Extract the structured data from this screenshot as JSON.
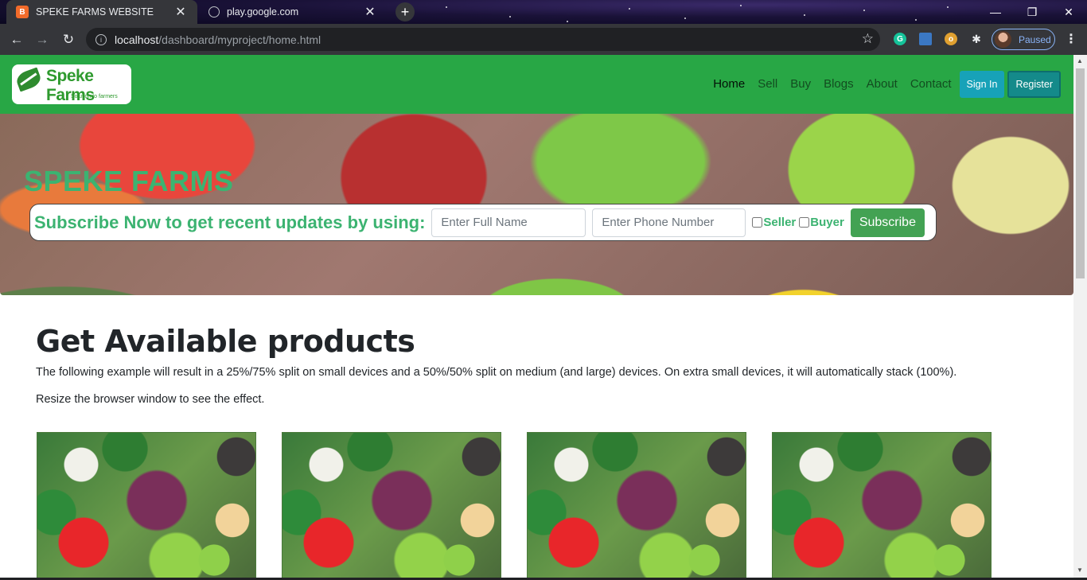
{
  "browser": {
    "tabs": [
      {
        "title": "SPEKE FARMS WEBSITE",
        "active": true,
        "favicon": "brand-icon"
      },
      {
        "title": "play.google.com",
        "active": false,
        "favicon": "globe-icon"
      }
    ],
    "url_host": "localhost",
    "url_path": "/dashboard/myproject/home.html",
    "profile_status": "Paused"
  },
  "site": {
    "logo_name": "Speke Farms",
    "logo_tagline": "Solution to farmers",
    "nav": {
      "links": [
        "Home",
        "Sell",
        "Buy",
        "Blogs",
        "About",
        "Contact"
      ],
      "active": "Home",
      "signin_label": "Sign In",
      "register_label": "Register"
    },
    "hero": {
      "title": "SPEKE FARMS",
      "subscribe_label": "Subscribe Now to get recent updates by using:",
      "name_placeholder": "Enter Full Name",
      "phone_placeholder": "Enter Phone Number",
      "seller_label": "Seller",
      "buyer_label": "Buyer",
      "subscribe_button": "Subscribe"
    },
    "main": {
      "heading": "Get Available products",
      "paragraph1": "The following example will result in a 25%/75% split on small devices and a 50%/50% split on medium (and large) devices. On extra small devices, it will automatically stack (100%).",
      "paragraph2": "Resize the browser window to see the effect."
    },
    "colors": {
      "nav_bg": "#28a745",
      "accent_green": "#3cb371",
      "signin_bg": "#17a2b8",
      "register_bg": "#148a8a"
    }
  }
}
